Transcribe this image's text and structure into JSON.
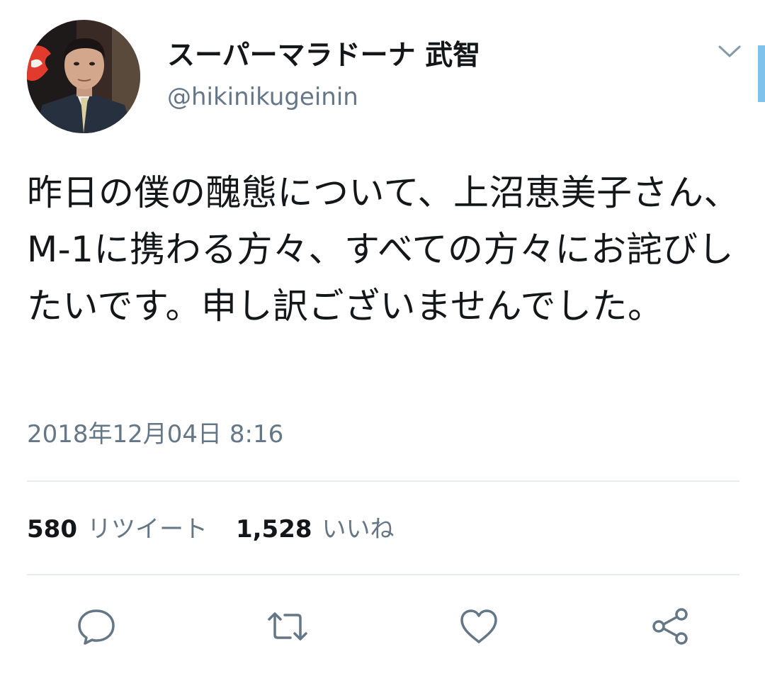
{
  "user": {
    "display_name": "スーパーマラドーナ 武智",
    "handle": "@hikinikugeinin"
  },
  "tweet": {
    "text": "昨日の僕の醜態について、上沼恵美子さん、 M-1に携わる方々、すべての方々にお詫びしたいです。申し訳ございませんでした。",
    "timestamp": "2018年12月04日 8:16"
  },
  "stats": {
    "retweet_count": "580",
    "retweet_label": "リツイート",
    "like_count": "1,528",
    "like_label": "いいね"
  },
  "icons": {
    "menu": "chevron-down-icon",
    "reply": "speech-bubble-icon",
    "retweet": "retweet-arrows-icon",
    "like": "heart-icon",
    "share": "share-nodes-icon"
  },
  "colors": {
    "text_primary": "#14171a",
    "text_secondary": "#657786",
    "divider": "#e6ecf0",
    "icon": "#657786",
    "scroll_indicator": "#7fc3ec"
  }
}
